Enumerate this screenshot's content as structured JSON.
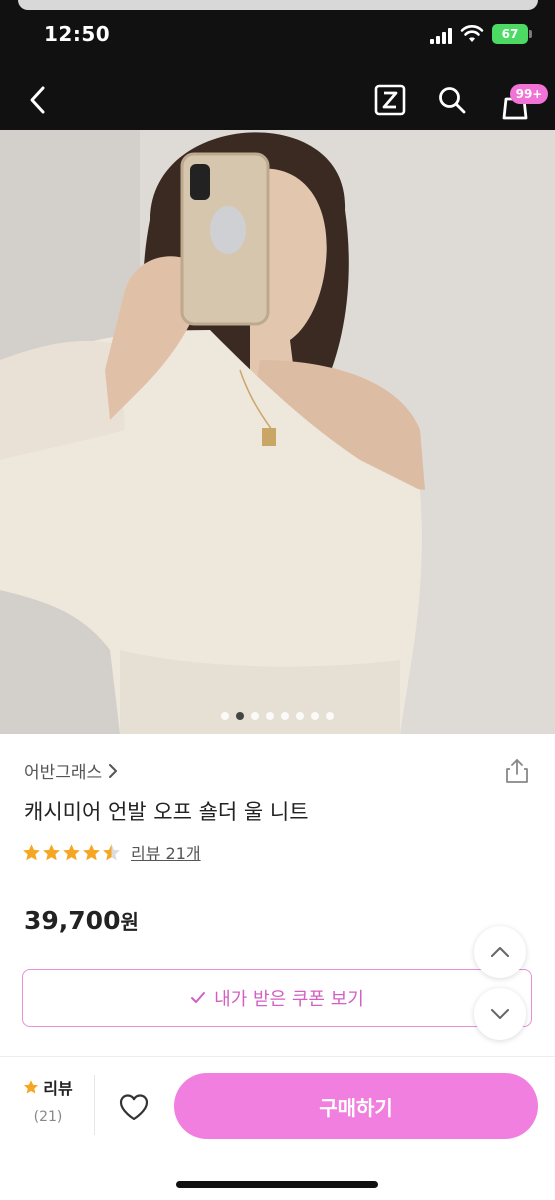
{
  "status_bar": {
    "time": "12:50",
    "battery": "67"
  },
  "nav": {
    "cart_badge": "99+",
    "icons": [
      "back-arrow-icon",
      "zigzag-z-icon",
      "search-icon",
      "cart-bag-icon"
    ]
  },
  "hero": {
    "image_count": 8,
    "active_index": 1
  },
  "product": {
    "brand": "어반그래스",
    "title": "캐시미어 언발 오프 숄더 울 니트",
    "rating": 4.5,
    "review_link": "리뷰 21개",
    "price": "39,700",
    "currency": "원"
  },
  "coupon": {
    "label": "내가 받은 쿠폰 보기"
  },
  "bottom_bar": {
    "review_label": "리뷰",
    "review_count": "(21)",
    "buy_label": "구매하기"
  },
  "colors": {
    "accent": "#f07fdf",
    "coupon_text": "#d35fc4",
    "star": "#f5a623",
    "nav_bg": "#111111"
  }
}
